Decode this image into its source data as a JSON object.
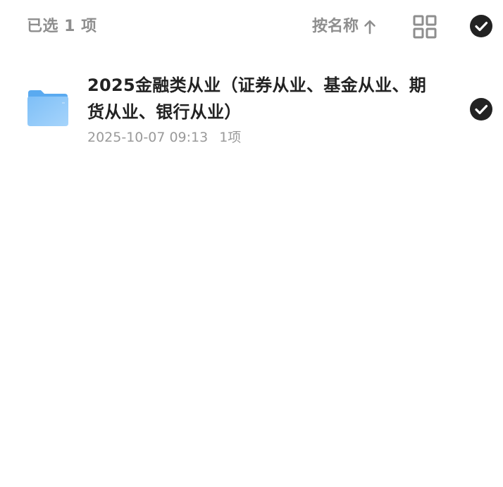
{
  "header": {
    "selected_count": "已选 1 项",
    "sort_label": "按名称",
    "sort_icon": "arrow-up-icon",
    "view_icon": "grid-view-icon",
    "select_all_icon": "check-circle-icon"
  },
  "items": [
    {
      "title": "2025金融类从业（证券从业、基金从业、期货从业、银行从业）",
      "date": "2025-10-07 09:13",
      "count": "1项",
      "selected": true,
      "icon": "folder-icon"
    }
  ],
  "colors": {
    "check_fill": "#222222",
    "folder_back": "#5aaaf0",
    "folder_front": "#8cc8fa",
    "muted_text": "#8e8e8e",
    "title_text": "#222222"
  }
}
